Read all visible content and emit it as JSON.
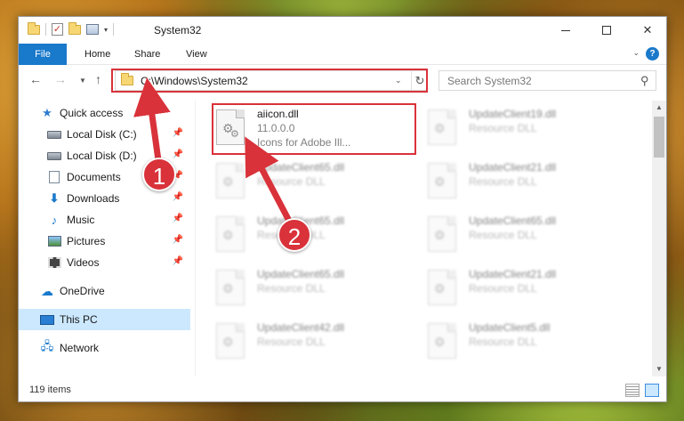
{
  "window": {
    "title": "System32",
    "minimize_label": "—",
    "close_label": "✕"
  },
  "ribbon": {
    "tabs": [
      "File",
      "Home",
      "Share",
      "View"
    ],
    "expand_label": "⌄",
    "help_label": "?"
  },
  "nav": {
    "back": "←",
    "forward": "→",
    "recent": "▼",
    "up": "↑",
    "address_value": "C:\\Windows\\System32",
    "address_drop": "⌄",
    "refresh": "↻",
    "search_placeholder": "Search System32",
    "search_icon": "⚲"
  },
  "sidebar": {
    "items": [
      {
        "label": "Quick access",
        "icon": "star-icon",
        "pinned": false
      },
      {
        "label": "Local Disk (C:)",
        "icon": "disk-icon",
        "pinned": true
      },
      {
        "label": "Local Disk (D:)",
        "icon": "disk-icon",
        "pinned": true
      },
      {
        "label": "Documents",
        "icon": "documents-icon",
        "pinned": true
      },
      {
        "label": "Downloads",
        "icon": "downloads-icon",
        "pinned": true
      },
      {
        "label": "Music",
        "icon": "music-icon",
        "pinned": true
      },
      {
        "label": "Pictures",
        "icon": "pictures-icon",
        "pinned": true
      },
      {
        "label": "Videos",
        "icon": "videos-icon",
        "pinned": true
      },
      {
        "label": "OneDrive",
        "icon": "onedrive-icon",
        "pinned": false
      },
      {
        "label": "This PC",
        "icon": "this-pc-icon",
        "pinned": false,
        "selected": true
      },
      {
        "label": "Network",
        "icon": "network-icon",
        "pinned": false
      }
    ],
    "pin_glyph": "📌"
  },
  "files": {
    "selected": {
      "name": "aiicon.dll",
      "line2": "11.0.0.0",
      "line3": "Icons for Adobe Ill..."
    },
    "left_column": [
      {
        "name": "UpdateClient65.dll",
        "type": "Resource DLL"
      },
      {
        "name": "UpdateClient65.dll",
        "type": "Resource DLL"
      },
      {
        "name": "UpdateClient65.dll",
        "type": "Resource DLL"
      },
      {
        "name": "UpdateClient42.dll",
        "type": "Resource DLL"
      }
    ],
    "right_column": [
      {
        "name": "UpdateClient19.dll",
        "type": "Resource DLL"
      },
      {
        "name": "UpdateClient21.dll",
        "type": "Resource DLL"
      },
      {
        "name": "UpdateClient65.dll",
        "type": "Resource DLL"
      },
      {
        "name": "UpdateClient21.dll",
        "type": "Resource DLL"
      },
      {
        "name": "UpdateClient5.dll",
        "type": "Resource DLL"
      }
    ],
    "gear_glyph": "⚙"
  },
  "status": {
    "item_count": "119 items"
  },
  "annotations": {
    "callout_1": "1",
    "callout_2": "2",
    "color": "#d9323a"
  }
}
